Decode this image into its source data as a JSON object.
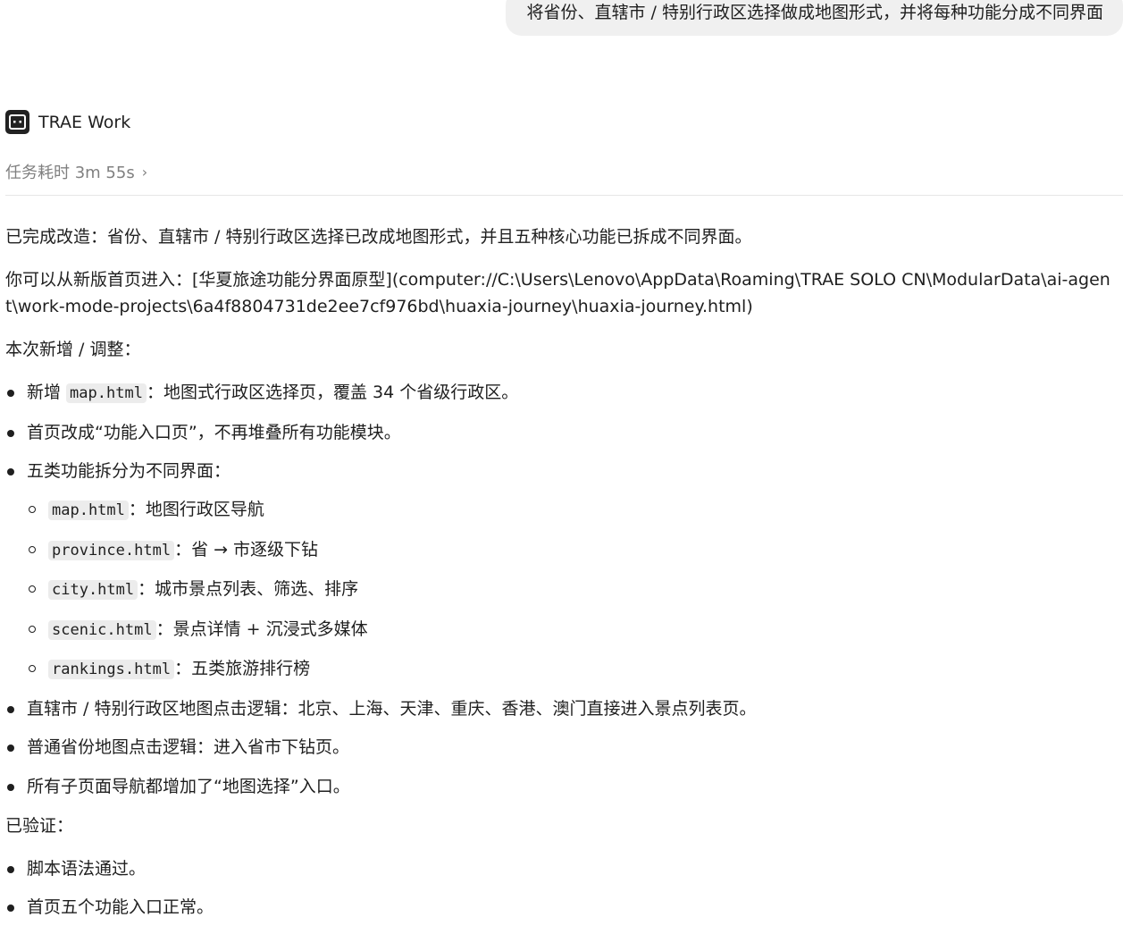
{
  "user_message": "将省份、直辖市 / 特别行政区选择做成地图形式，并将每种功能分成不同界面",
  "agent": {
    "name": "TRAE Work",
    "task_time": "任务耗时 3m 55s",
    "logo_icon": "trae-logo-icon"
  },
  "response": {
    "summary": "已完成改造：省份、直辖市 / 特别行政区选择已改成地图形式，并且五种核心功能已拆成不同界面。",
    "entry_text": "你可以从新版首页进入：[华夏旅途功能分界面原型](computer://C:\\Users\\Lenovo\\AppData\\Roaming\\TRAE SOLO CN\\ModularData\\ai-agent\\work-mode-projects\\6a4f8804731de2ee7cf976bd\\huaxia-journey\\huaxia-journey.html)",
    "changes_heading": "本次新增 / 调整：",
    "changes": [
      {
        "prefix": "新增 ",
        "code": "map.html",
        "text": "：地图式行政区选择页，覆盖 34 个省级行政区。"
      },
      {
        "prefix": "",
        "code": "",
        "text": "首页改成“功能入口页”，不再堆叠所有功能模块。"
      },
      {
        "prefix": "",
        "code": "",
        "text": "五类功能拆分为不同界面："
      },
      {
        "prefix": "",
        "code": "",
        "text": "直辖市 / 特别行政区地图点击逻辑：北京、上海、天津、重庆、香港、澳门直接进入景点列表页。"
      },
      {
        "prefix": "",
        "code": "",
        "text": "普通省份地图点击逻辑：进入省市下钻页。"
      },
      {
        "prefix": "",
        "code": "",
        "text": "所有子页面导航都增加了“地图选择”入口。"
      }
    ],
    "pages": [
      {
        "code": "map.html",
        "text": "：地图行政区导航"
      },
      {
        "code": "province.html",
        "text": "：省 → 市逐级下钻"
      },
      {
        "code": "city.html",
        "text": "：城市景点列表、筛选、排序"
      },
      {
        "code": "scenic.html",
        "text": "：景点详情 + 沉浸式多媒体"
      },
      {
        "code": "rankings.html",
        "text": "：五类旅游排行榜"
      }
    ],
    "verified_heading": "已验证：",
    "verified": [
      "脚本语法通过。",
      "首页五个功能入口正常。"
    ]
  }
}
